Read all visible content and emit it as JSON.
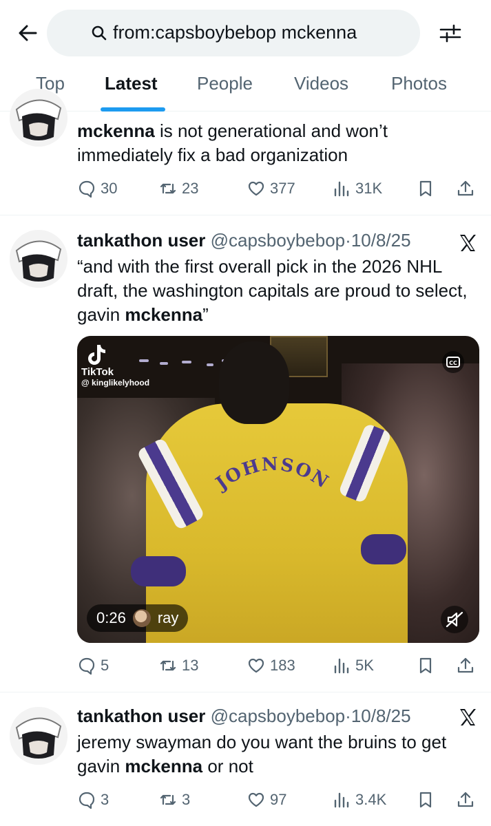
{
  "search": {
    "query": "from:capsboybebop mckenna"
  },
  "tabs": [
    {
      "label": "Top"
    },
    {
      "label": "Latest"
    },
    {
      "label": "People"
    },
    {
      "label": "Videos"
    },
    {
      "label": "Photos"
    }
  ],
  "active_tab": "Latest",
  "colors": {
    "accent": "#1d9bf0",
    "secondary_text": "#536471",
    "primary_text": "#0f1419"
  },
  "tweets": [
    {
      "text_bold_1": "mckenna",
      "text_after_1": " is not generational and won’t immediately fix a bad organization",
      "stats": {
        "replies": "30",
        "reposts": "23",
        "likes": "377",
        "views": "31K"
      }
    },
    {
      "name": "tankathon user",
      "handle": "@capsboybebop",
      "separator": "·",
      "date": "10/8/25",
      "text_before_1": "“and with the first overall pick in the 2026 NHL draft, the washington capitals are proud to select, gavin ",
      "text_bold_1": "mckenna",
      "text_after_1": "”",
      "video": {
        "watermark_brand": "TikTok",
        "watermark_user": "@ kinglikelyhood",
        "jersey_text": "JOHNSON",
        "duration": "0:26",
        "uploader": "ray"
      },
      "stats": {
        "replies": "5",
        "reposts": "13",
        "likes": "183",
        "views": "5K"
      }
    },
    {
      "name": "tankathon user",
      "handle": "@capsboybebop",
      "separator": "·",
      "date": "10/8/25",
      "text_before_1": "jeremy swayman do you want the bruins to get gavin ",
      "text_bold_1": "mckenna",
      "text_after_1": " or not",
      "stats": {
        "replies": "3",
        "reposts": "3",
        "likes": "97",
        "views": "3.4K"
      }
    }
  ]
}
